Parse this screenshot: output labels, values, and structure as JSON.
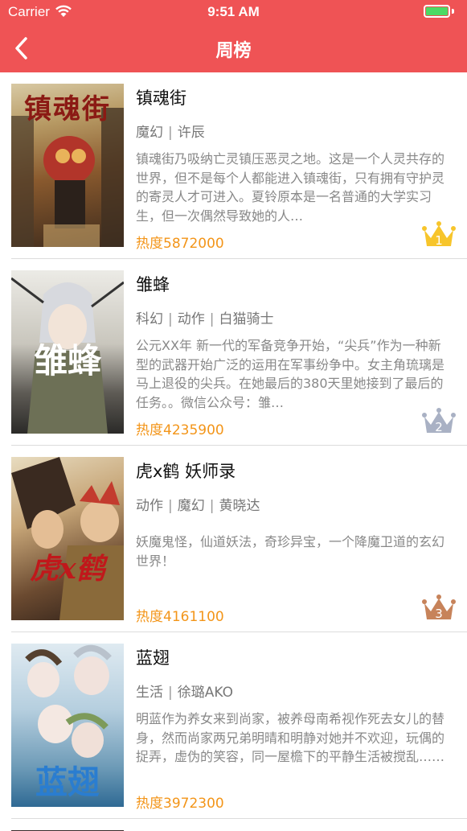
{
  "status": {
    "carrier": "Carrier",
    "time": "9:51 AM"
  },
  "nav": {
    "title": "周榜"
  },
  "colors": {
    "accent": "#ef5355",
    "heat": "#f39519",
    "gold": "#f7c52b",
    "silver": "#a9b1c4",
    "bronze": "#c7835a"
  },
  "items": [
    {
      "title": "镇魂街",
      "tags": [
        "魔幻",
        "许辰"
      ],
      "desc": "镇魂街乃吸纳亡灵镇压恶灵之地。这是一个人灵共存的世界，但不是每个人都能进入镇魂街，只有拥有守护灵的寄灵人才可进入。夏铃原本是一名普通的大学实习生，但一次偶然导致她的人…",
      "heat": "热度5872000",
      "rank": "1",
      "crown_icon": "crown-gold-icon",
      "cover_text": "镇魂街"
    },
    {
      "title": "雏蜂",
      "tags": [
        "科幻",
        "动作",
        "白猫骑士"
      ],
      "desc": "公元XX年 新一代的军备竞争开始，“尖兵”作为一种新型的武器开始广泛的运用在军事纷争中。女主角琉璃是马上退役的尖兵。在她最后的380天里她接到了最后的任务。。微信公众号：雏…",
      "heat": "热度4235900",
      "rank": "2",
      "crown_icon": "crown-silver-icon",
      "cover_text": "雏蜂"
    },
    {
      "title": "虎x鹤 妖师录",
      "tags": [
        "动作",
        "魔幻",
        "黄晓达"
      ],
      "desc": "妖魔鬼怪，仙道妖法，奇珍异宝，一个降魔卫道的玄幻世界！",
      "heat": "热度4161100",
      "rank": "3",
      "crown_icon": "crown-bronze-icon",
      "cover_text": "虎x鹤"
    },
    {
      "title": "蓝翅",
      "tags": [
        "生活",
        "徐璐AKO"
      ],
      "desc": "明蓝作为养女来到尚家，被养母南希视作死去女儿的替身，然而尚家两兄弟明晴和明静对她并不欢迎，玩偶的捉弄，虚伪的笑容，同一屋檐下的平静生活被搅乱……",
      "heat": "热度3972300",
      "rank": "",
      "crown_icon": "",
      "cover_text": "蓝翅"
    }
  ]
}
